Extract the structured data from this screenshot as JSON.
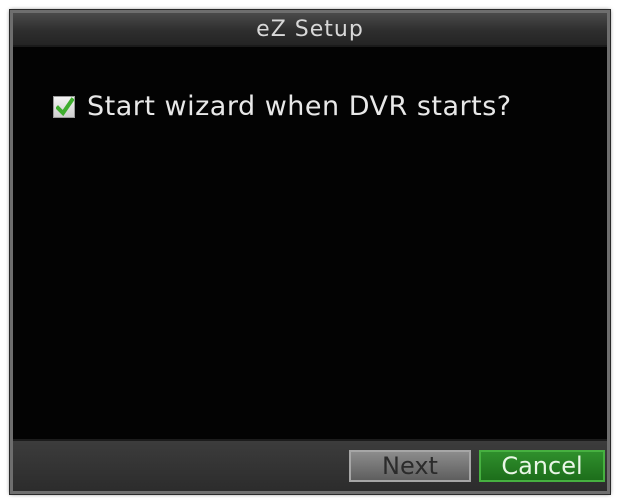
{
  "dialog": {
    "title": "eZ Setup",
    "option": {
      "label": "Start wizard when DVR starts?",
      "checked": true
    },
    "buttons": {
      "next_label": "Next",
      "cancel_label": "Cancel"
    }
  },
  "colors": {
    "background": "#050505",
    "title_bar": "#333333",
    "cancel_button": "#237f21",
    "next_button": "#747474",
    "check_mark": "#3fae2f"
  },
  "icons": {
    "checkbox": "check-mark-icon"
  }
}
